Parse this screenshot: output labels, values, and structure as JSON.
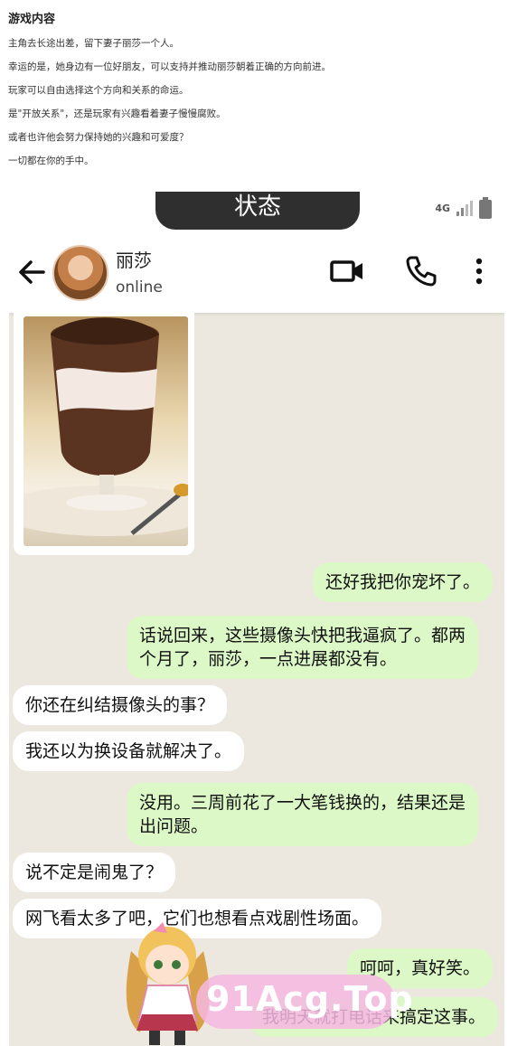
{
  "intro": {
    "title": "游戏内容",
    "lines": [
      "主角去长途出差，留下妻子丽莎一个人。",
      "幸运的是，她身边有一位好朋友，可以支持并推动丽莎朝着正确的方向前进。",
      "玩家可以自由选择这个方向和关系的命运。",
      "是\"开放关系\"，还是玩家有兴趣看着妻子慢慢腐败。",
      "或者也许他会努力保持她的兴趣和可爱度？",
      "一切都在你的手中。"
    ]
  },
  "statusbar": {
    "label": "状态",
    "network": "4G"
  },
  "header": {
    "name": "丽莎",
    "status": "online"
  },
  "messages": [
    {
      "side": "sent",
      "text": "还好我把你宠坏了。"
    },
    {
      "side": "sent",
      "text": "话说回来，这些摄像头快把我逼疯了。都两\n个月了，丽莎，一点进展都没有。"
    },
    {
      "side": "recv",
      "text": "你还在纠结摄像头的事？"
    },
    {
      "side": "recv",
      "text": "我还以为换设备就解决了。"
    },
    {
      "side": "sent",
      "text": "没用。三周前花了一大笔钱换的，结果还是\n出问题。"
    },
    {
      "side": "recv",
      "text": "说不定是闹鬼了？"
    },
    {
      "side": "recv",
      "text": "网飞看太多了吧，它们也想看点戏剧性场面。"
    },
    {
      "side": "sent",
      "text": "呵呵，真好笑。"
    },
    {
      "side": "sent",
      "text": "我明天就打电话来搞定这事。"
    }
  ],
  "watermark": {
    "text": "91Acg.Top"
  }
}
